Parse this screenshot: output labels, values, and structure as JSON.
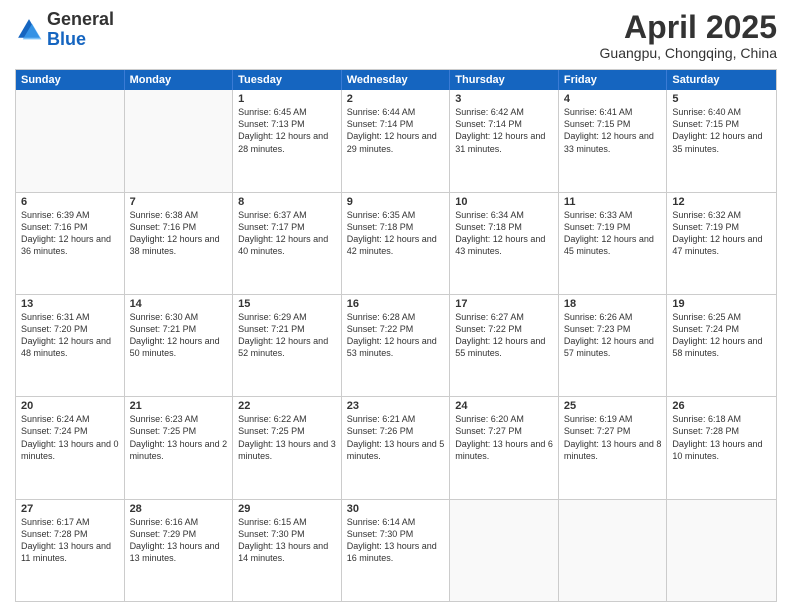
{
  "header": {
    "logo_general": "General",
    "logo_blue": "Blue",
    "month_title": "April 2025",
    "subtitle": "Guangpu, Chongqing, China"
  },
  "days_of_week": [
    "Sunday",
    "Monday",
    "Tuesday",
    "Wednesday",
    "Thursday",
    "Friday",
    "Saturday"
  ],
  "weeks": [
    [
      {
        "day": "",
        "text": ""
      },
      {
        "day": "",
        "text": ""
      },
      {
        "day": "1",
        "text": "Sunrise: 6:45 AM\nSunset: 7:13 PM\nDaylight: 12 hours and 28 minutes."
      },
      {
        "day": "2",
        "text": "Sunrise: 6:44 AM\nSunset: 7:14 PM\nDaylight: 12 hours and 29 minutes."
      },
      {
        "day": "3",
        "text": "Sunrise: 6:42 AM\nSunset: 7:14 PM\nDaylight: 12 hours and 31 minutes."
      },
      {
        "day": "4",
        "text": "Sunrise: 6:41 AM\nSunset: 7:15 PM\nDaylight: 12 hours and 33 minutes."
      },
      {
        "day": "5",
        "text": "Sunrise: 6:40 AM\nSunset: 7:15 PM\nDaylight: 12 hours and 35 minutes."
      }
    ],
    [
      {
        "day": "6",
        "text": "Sunrise: 6:39 AM\nSunset: 7:16 PM\nDaylight: 12 hours and 36 minutes."
      },
      {
        "day": "7",
        "text": "Sunrise: 6:38 AM\nSunset: 7:16 PM\nDaylight: 12 hours and 38 minutes."
      },
      {
        "day": "8",
        "text": "Sunrise: 6:37 AM\nSunset: 7:17 PM\nDaylight: 12 hours and 40 minutes."
      },
      {
        "day": "9",
        "text": "Sunrise: 6:35 AM\nSunset: 7:18 PM\nDaylight: 12 hours and 42 minutes."
      },
      {
        "day": "10",
        "text": "Sunrise: 6:34 AM\nSunset: 7:18 PM\nDaylight: 12 hours and 43 minutes."
      },
      {
        "day": "11",
        "text": "Sunrise: 6:33 AM\nSunset: 7:19 PM\nDaylight: 12 hours and 45 minutes."
      },
      {
        "day": "12",
        "text": "Sunrise: 6:32 AM\nSunset: 7:19 PM\nDaylight: 12 hours and 47 minutes."
      }
    ],
    [
      {
        "day": "13",
        "text": "Sunrise: 6:31 AM\nSunset: 7:20 PM\nDaylight: 12 hours and 48 minutes."
      },
      {
        "day": "14",
        "text": "Sunrise: 6:30 AM\nSunset: 7:21 PM\nDaylight: 12 hours and 50 minutes."
      },
      {
        "day": "15",
        "text": "Sunrise: 6:29 AM\nSunset: 7:21 PM\nDaylight: 12 hours and 52 minutes."
      },
      {
        "day": "16",
        "text": "Sunrise: 6:28 AM\nSunset: 7:22 PM\nDaylight: 12 hours and 53 minutes."
      },
      {
        "day": "17",
        "text": "Sunrise: 6:27 AM\nSunset: 7:22 PM\nDaylight: 12 hours and 55 minutes."
      },
      {
        "day": "18",
        "text": "Sunrise: 6:26 AM\nSunset: 7:23 PM\nDaylight: 12 hours and 57 minutes."
      },
      {
        "day": "19",
        "text": "Sunrise: 6:25 AM\nSunset: 7:24 PM\nDaylight: 12 hours and 58 minutes."
      }
    ],
    [
      {
        "day": "20",
        "text": "Sunrise: 6:24 AM\nSunset: 7:24 PM\nDaylight: 13 hours and 0 minutes."
      },
      {
        "day": "21",
        "text": "Sunrise: 6:23 AM\nSunset: 7:25 PM\nDaylight: 13 hours and 2 minutes."
      },
      {
        "day": "22",
        "text": "Sunrise: 6:22 AM\nSunset: 7:25 PM\nDaylight: 13 hours and 3 minutes."
      },
      {
        "day": "23",
        "text": "Sunrise: 6:21 AM\nSunset: 7:26 PM\nDaylight: 13 hours and 5 minutes."
      },
      {
        "day": "24",
        "text": "Sunrise: 6:20 AM\nSunset: 7:27 PM\nDaylight: 13 hours and 6 minutes."
      },
      {
        "day": "25",
        "text": "Sunrise: 6:19 AM\nSunset: 7:27 PM\nDaylight: 13 hours and 8 minutes."
      },
      {
        "day": "26",
        "text": "Sunrise: 6:18 AM\nSunset: 7:28 PM\nDaylight: 13 hours and 10 minutes."
      }
    ],
    [
      {
        "day": "27",
        "text": "Sunrise: 6:17 AM\nSunset: 7:28 PM\nDaylight: 13 hours and 11 minutes."
      },
      {
        "day": "28",
        "text": "Sunrise: 6:16 AM\nSunset: 7:29 PM\nDaylight: 13 hours and 13 minutes."
      },
      {
        "day": "29",
        "text": "Sunrise: 6:15 AM\nSunset: 7:30 PM\nDaylight: 13 hours and 14 minutes."
      },
      {
        "day": "30",
        "text": "Sunrise: 6:14 AM\nSunset: 7:30 PM\nDaylight: 13 hours and 16 minutes."
      },
      {
        "day": "",
        "text": ""
      },
      {
        "day": "",
        "text": ""
      },
      {
        "day": "",
        "text": ""
      }
    ]
  ]
}
